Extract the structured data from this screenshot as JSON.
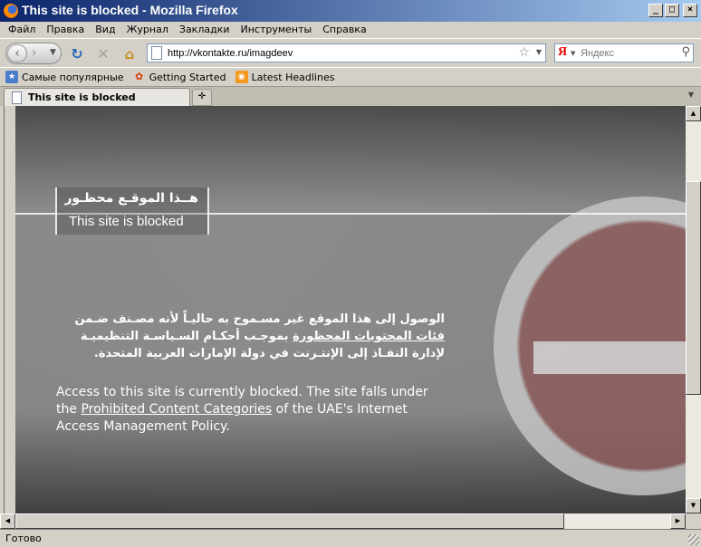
{
  "window": {
    "title": "This site is blocked - Mozilla Firefox",
    "minimize_glyph": "_",
    "maximize_glyph": "□",
    "close_glyph": "×"
  },
  "menu": [
    "Файл",
    "Правка",
    "Вид",
    "Журнал",
    "Закладки",
    "Инструменты",
    "Справка"
  ],
  "nav": {
    "back_glyph": "‹",
    "forward_glyph": "›",
    "reload_glyph": "↻",
    "stop_glyph": "✕",
    "home_glyph": "⌂",
    "url": "http://vkontakte.ru/imagdeev",
    "search_engine_glyph": "Я",
    "search_placeholder": "Яндекс"
  },
  "bookmarks": [
    {
      "label": "Самые популярные",
      "icon": "popular-icon"
    },
    {
      "label": "Getting Started",
      "icon": "getting-started-icon"
    },
    {
      "label": "Latest Headlines",
      "icon": "rss-icon"
    }
  ],
  "tabs": [
    {
      "label": "This site is blocked",
      "active": true
    }
  ],
  "page": {
    "title_ar": "هــذا الموقـع محظـور",
    "title_en": "This site is blocked",
    "message_ar_1": "الوصول إلى هذا الموقع غير مسـموح به حاليـاً لأنه مصـنف ضـمن",
    "message_ar_link": "فئات المحتويات المحظورة",
    "message_ar_2": "بموجـب أحكـام السـياسـة التنظيميـة",
    "message_ar_3": "لإدارة النفـاذ إلى الإنتـرنت في دولة الإمارات العربية المتحدة.",
    "message_en_1": "Access to this site is currently blocked.  The site falls under the",
    "message_en_link": "Prohibited Content Categories",
    "message_en_2": "of the UAE's Internet Access Management Policy."
  },
  "status": {
    "text": "Готово"
  },
  "colors": {
    "titlebar_start": "#0a246a",
    "titlebar_end": "#a6caf0",
    "chrome": "#d4d0c8"
  }
}
